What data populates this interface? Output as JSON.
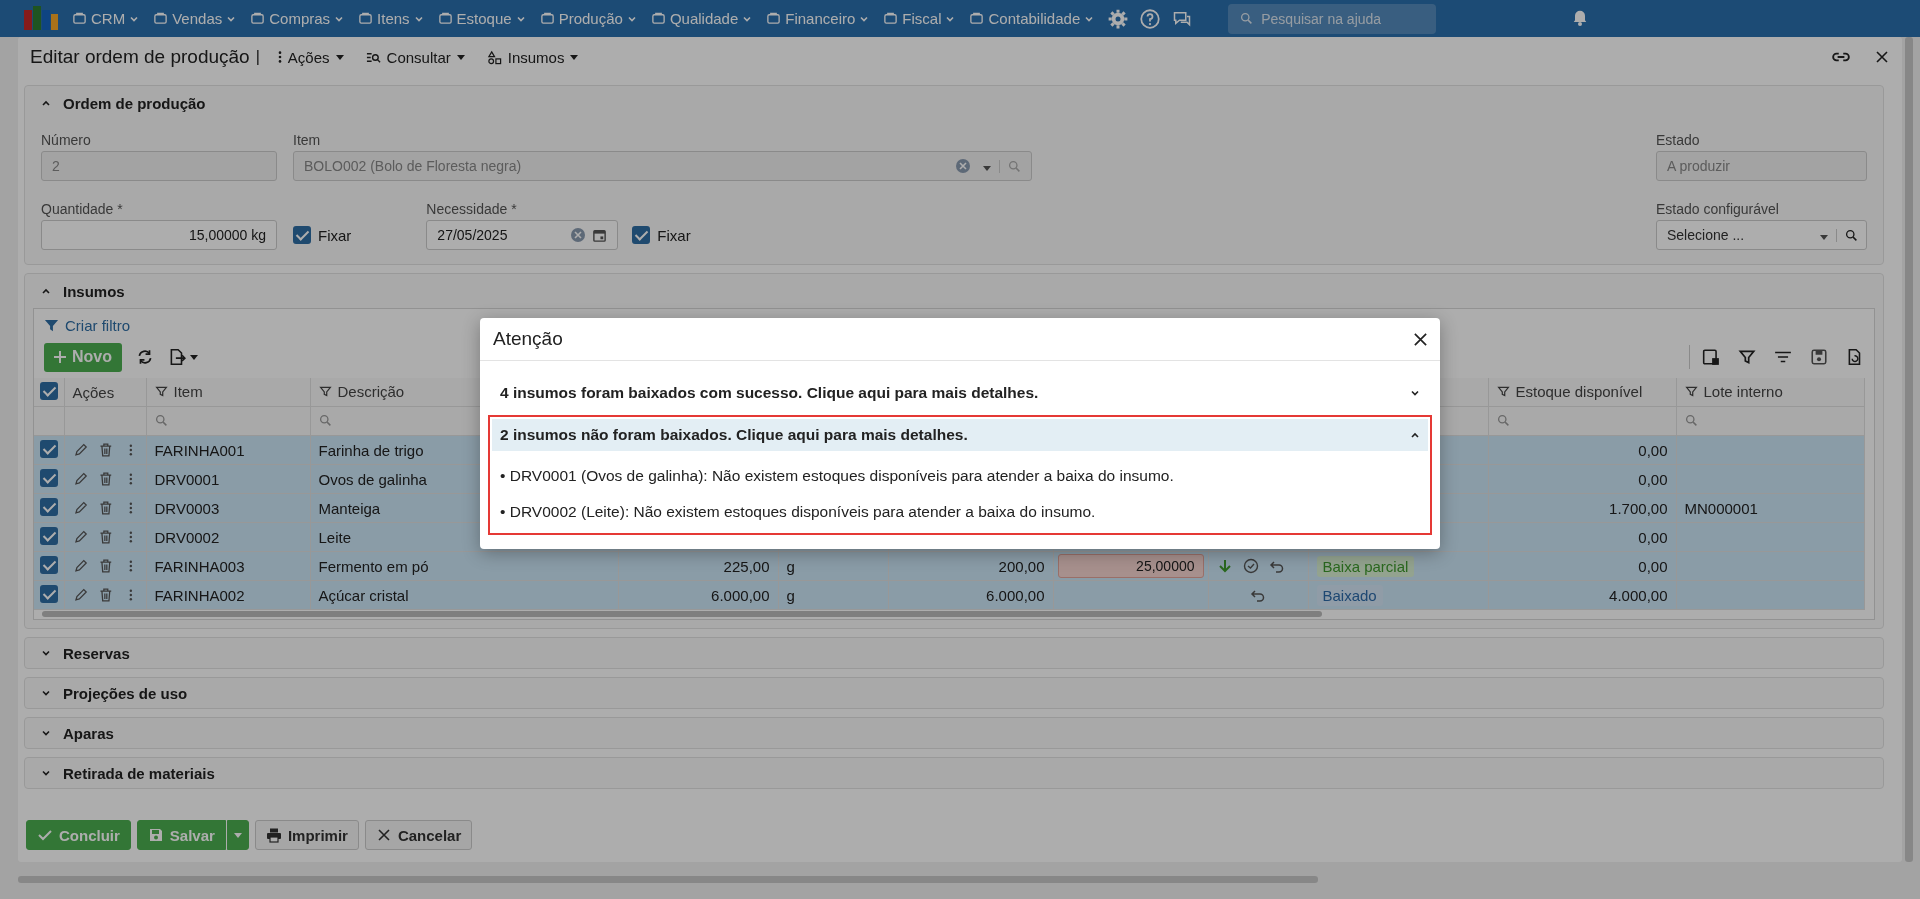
{
  "navbar": {
    "menus": [
      "CRM",
      "Vendas",
      "Compras",
      "Itens",
      "Estoque",
      "Produção",
      "Qualidade",
      "Financeiro",
      "Fiscal",
      "Contabilidade"
    ],
    "search": {
      "placeholder": "Pesquisar na ajuda"
    }
  },
  "window": {
    "title": "Editar ordem de produção",
    "separator": "|",
    "menus": [
      "Ações",
      "Consultar",
      "Insumos"
    ]
  },
  "order_section": {
    "title": "Ordem de produção",
    "expanded": true,
    "number": {
      "label": "Número",
      "value": "2"
    },
    "item": {
      "label": "Item",
      "value": "BOLO002 (Bolo de Floresta negra)"
    },
    "state": {
      "label": "Estado",
      "value": "A produzir"
    },
    "quantity": {
      "label": "Quantidade *",
      "value": "15,00000 kg"
    },
    "fix_quantity": {
      "label": "Fixar",
      "checked": true
    },
    "need_date": {
      "label": "Necessidade *",
      "value": "27/05/2025"
    },
    "fix_date": {
      "label": "Fixar",
      "checked": true
    },
    "configurable_state": {
      "label": "Estado configurável",
      "placeholder": "Selecione ..."
    }
  },
  "inputs_section": {
    "title": "Insumos",
    "expanded": true,
    "create_filter": "Criar filtro",
    "new_button": "Novo",
    "all_checked": true,
    "columns": {
      "actions": "Ações",
      "item": "Item",
      "description": "Descrição",
      "stock": "Estoque disponível",
      "lot": "Lote interno"
    },
    "rows": [
      {
        "checked": true,
        "item": "FARINHA001",
        "description": "Farinha de trigo",
        "stock": "0,00"
      },
      {
        "checked": true,
        "item": "DRV0001",
        "description": "Ovos de galinha",
        "stock": "0,00"
      },
      {
        "checked": true,
        "item": "DRV0003",
        "description": "Manteiga",
        "stock": "1.700,00",
        "lot": "MN000001"
      },
      {
        "checked": true,
        "item": "DRV0002",
        "description": "Leite",
        "stock": "0,00"
      },
      {
        "checked": true,
        "item": "FARINHA003",
        "description": "Fermento em pó",
        "quantity": "225,00",
        "unit": "g",
        "quantity_2": "200,00",
        "pending": "25,00000",
        "status": {
          "label": "Baixa parcial",
          "kind": "partial"
        },
        "stock": "0,00"
      },
      {
        "checked": true,
        "item": "FARINHA002",
        "description": "Açúcar cristal",
        "quantity": "6.000,00",
        "unit": "g",
        "quantity_2": "6.000,00",
        "status": {
          "label": "Baixado",
          "kind": "done"
        },
        "stock": "4.000,00"
      }
    ]
  },
  "collapsed_sections": [
    {
      "title": "Reservas",
      "expanded": false
    },
    {
      "title": "Projeções de uso",
      "expanded": false
    },
    {
      "title": "Aparas",
      "expanded": false
    },
    {
      "title": "Retirada de materiais",
      "expanded": false
    }
  ],
  "footer_buttons": [
    {
      "label": "Concluir",
      "kind": "confirm"
    },
    {
      "label": "Salvar",
      "kind": "save"
    },
    {
      "label": "Imprimir",
      "kind": "print"
    },
    {
      "label": "Cancelar",
      "kind": "cancel"
    }
  ],
  "dialog": {
    "title": "Atenção",
    "sections": [
      {
        "text": "4 insumos foram baixados com sucesso. Clique aqui para mais detalhes.",
        "expanded": false,
        "highlighted": false
      },
      {
        "text": "2 insumos não foram baixados. Clique aqui para mais detalhes.",
        "expanded": true,
        "highlighted": true,
        "details": [
          "• DRV0001 (Ovos de galinha): Não existem estoques disponíveis para atender a baixa do insumo.",
          "• DRV0002 (Leite): Não existem estoques disponíveis para atender a baixa do insumo."
        ]
      }
    ]
  }
}
